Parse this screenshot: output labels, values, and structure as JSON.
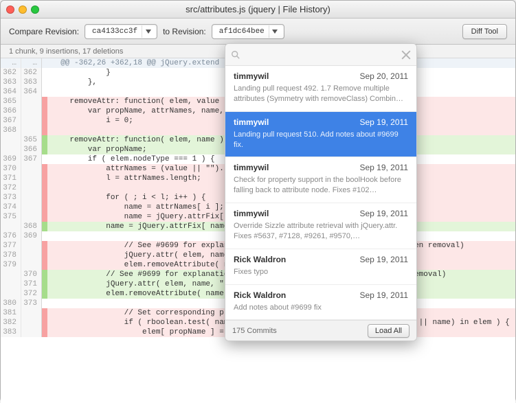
{
  "window": {
    "title": "src/attributes.js (jquery | File History)"
  },
  "toolbar": {
    "compare_label": "Compare Revision:",
    "to_label": "to Revision:",
    "rev_from": "ca4133cc3f",
    "rev_to": "af1dc64bee",
    "diff_tool_label": "Diff Tool"
  },
  "chunk_summary": "1 chunk, 9 insertions, 17 deletions",
  "hunk_header": "@@ -362,26 +362,18 @@ jQuery.extend",
  "diff_rows": [
    {
      "old": "362",
      "new": "362",
      "kind": "ctx",
      "text": "            }"
    },
    {
      "old": "363",
      "new": "363",
      "kind": "ctx",
      "text": "        },"
    },
    {
      "old": "364",
      "new": "364",
      "kind": "ctx",
      "text": ""
    },
    {
      "old": "365",
      "new": "",
      "kind": "del",
      "text": "    removeAttr: function( elem, value ) {"
    },
    {
      "old": "366",
      "new": "",
      "kind": "del",
      "text": "        var propName, attrNames, name,"
    },
    {
      "old": "367",
      "new": "",
      "kind": "del",
      "text": "            i = 0;"
    },
    {
      "old": "368",
      "new": "",
      "kind": "del",
      "text": ""
    },
    {
      "old": "",
      "new": "365",
      "kind": "add",
      "text": "    removeAttr: function( elem, name ) {"
    },
    {
      "old": "",
      "new": "366",
      "kind": "add",
      "text": "        var propName;"
    },
    {
      "old": "369",
      "new": "367",
      "kind": "ctx",
      "text": "        if ( elem.nodeType === 1 ) {"
    },
    {
      "old": "370",
      "new": "",
      "kind": "del",
      "text": "            attrNames = (value || \"\").split( rspace );"
    },
    {
      "old": "371",
      "new": "",
      "kind": "del",
      "text": "            l = attrNames.length;"
    },
    {
      "old": "372",
      "new": "",
      "kind": "del",
      "text": ""
    },
    {
      "old": "373",
      "new": "",
      "kind": "del",
      "text": "            for ( ; i < l; i++ ) {"
    },
    {
      "old": "374",
      "new": "",
      "kind": "del",
      "text": "                name = attrNames[ i ];"
    },
    {
      "old": "375",
      "new": "",
      "kind": "del",
      "text": "                name = jQuery.attrFix[ name ] || name;"
    },
    {
      "old": "",
      "new": "368",
      "kind": "add",
      "text": "            name = jQuery.attrFix[ name ] || name;"
    },
    {
      "old": "376",
      "new": "369",
      "kind": "ctx",
      "text": ""
    },
    {
      "old": "377",
      "new": "",
      "kind": "del",
      "text": "                // See #9699 for explanation of this approach (setting first, then removal)"
    },
    {
      "old": "378",
      "new": "",
      "kind": "del",
      "text": "                jQuery.attr( elem, name, \"\" );"
    },
    {
      "old": "379",
      "new": "",
      "kind": "del",
      "text": "                elem.removeAttribute( name );"
    },
    {
      "old": "",
      "new": "370",
      "kind": "add",
      "text": "            // See #9699 for explanation of this approach (setting first, then removal)"
    },
    {
      "old": "",
      "new": "371",
      "kind": "add",
      "text": "            jQuery.attr( elem, name, \"\" );"
    },
    {
      "old": "",
      "new": "372",
      "kind": "add",
      "text": "            elem.removeAttribute( name );"
    },
    {
      "old": "380",
      "new": "373",
      "kind": "ctx",
      "text": ""
    },
    {
      "old": "381",
      "new": "",
      "kind": "del",
      "text": "                // Set corresponding property to false for boolean attributes"
    },
    {
      "old": "382",
      "new": "",
      "kind": "del",
      "text": "                if ( rboolean.test( name ) && (propName = jQuery.propFix[ name ] || name) in elem ) {"
    },
    {
      "old": "383",
      "new": "",
      "kind": "del",
      "text": "                    elem[ propName ] = false;"
    }
  ],
  "popover": {
    "search_placeholder": "",
    "commits": [
      {
        "author": "timmywil",
        "date": "Sep 20, 2011",
        "msg": "Landing pull request 492. 1.7 Remove multiple attributes (Symmetry with removeClass) Combin…",
        "selected": false
      },
      {
        "author": "timmywil",
        "date": "Sep 19, 2011",
        "msg": "Landing pull request 510. Add notes about #9699 fix.",
        "selected": true
      },
      {
        "author": "timmywil",
        "date": "Sep 19, 2011",
        "msg": "Check for property support in the boolHook before falling back to attribute node. Fixes #102…",
        "selected": false
      },
      {
        "author": "timmywil",
        "date": "Sep 19, 2011",
        "msg": "Override Sizzle   attribute retrieval with jQuery.attr. Fixes #5637, #7128, #9261, #9570,…",
        "selected": false
      },
      {
        "author": "Rick Waldron",
        "date": "Sep 19, 2011",
        "msg": "Fixes typo",
        "selected": false
      },
      {
        "author": "Rick Waldron",
        "date": "Sep 19, 2011",
        "msg": "Add notes about #9699 fix",
        "selected": false
      }
    ],
    "footer_count": "175 Commits",
    "load_all_label": "Load All"
  }
}
